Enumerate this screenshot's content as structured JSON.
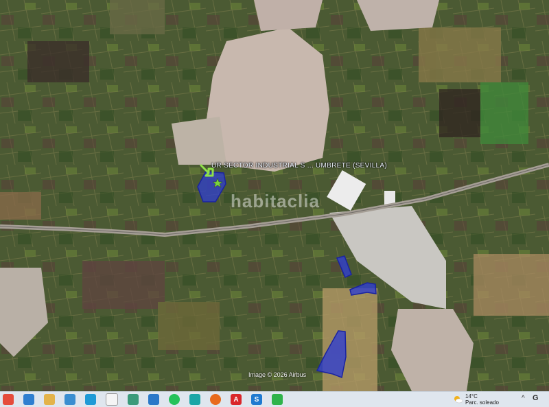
{
  "map": {
    "place_label": "UR SECTOR INDUSTRIAL S ... UMBRETE (SEVILLA)",
    "watermark": "habitaclia",
    "imagery_credit": "Image © 2026 Airbus"
  },
  "colors": {
    "parcel_fill": "#2f3fd0",
    "parcel_stroke": "#1a23a0",
    "marker_arrow": "#8fe04a",
    "marker_star": "#7bd23c"
  },
  "taskbar": {
    "apps": [
      {
        "name": "chrome",
        "glyph": ""
      },
      {
        "name": "maps",
        "glyph": ""
      },
      {
        "name": "folder",
        "glyph": ""
      },
      {
        "name": "photos",
        "glyph": ""
      },
      {
        "name": "edge",
        "glyph": ""
      },
      {
        "name": "file",
        "glyph": ""
      },
      {
        "name": "globe",
        "glyph": ""
      },
      {
        "name": "store",
        "glyph": ""
      },
      {
        "name": "whatsapp",
        "glyph": ""
      },
      {
        "name": "teams",
        "glyph": ""
      },
      {
        "name": "firefox",
        "glyph": ""
      },
      {
        "name": "acrobat",
        "glyph": "A"
      },
      {
        "name": "s-app",
        "glyph": "S"
      },
      {
        "name": "green-app",
        "glyph": ""
      }
    ],
    "weather": {
      "temp": "14°C",
      "condition": "Parc. soleado"
    },
    "tray_letter": "G"
  }
}
